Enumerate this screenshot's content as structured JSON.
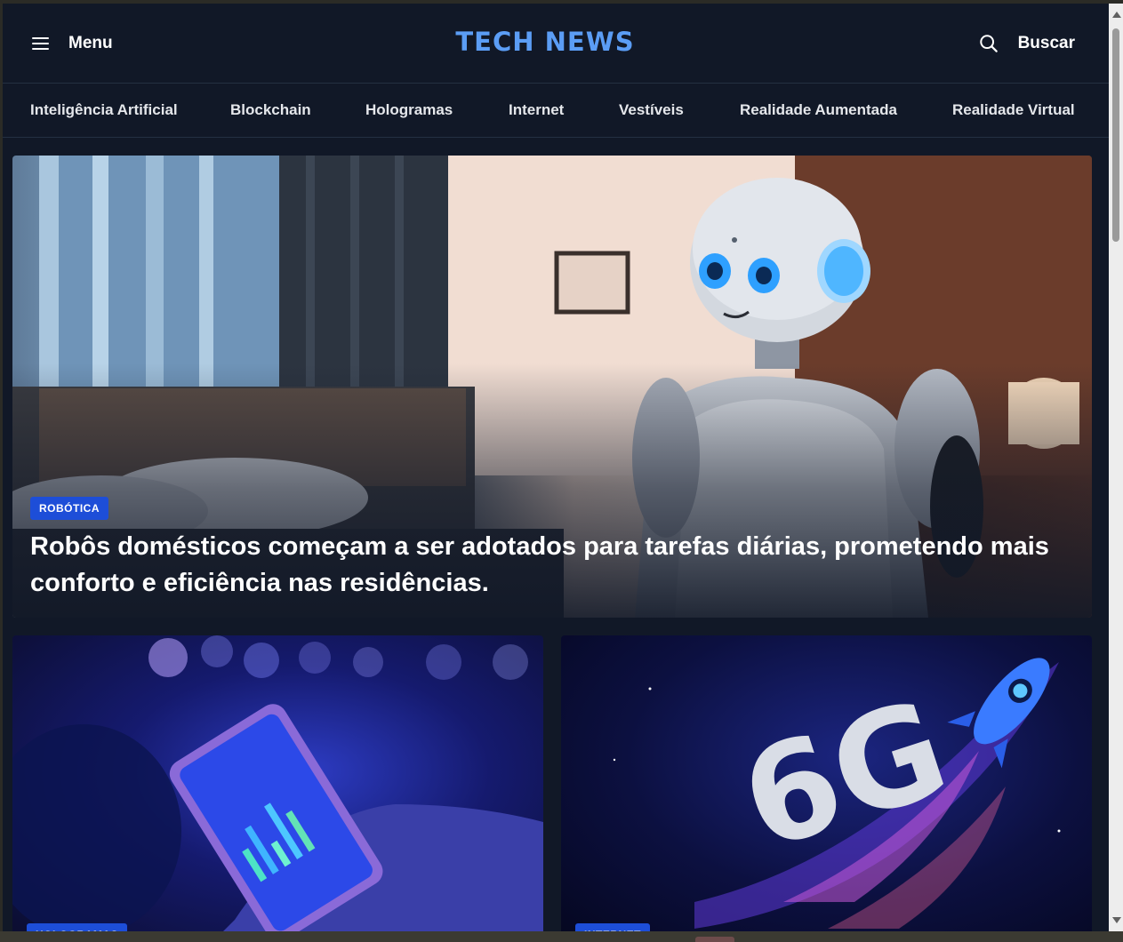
{
  "header": {
    "menu_label": "Menu",
    "logo": "TECH NEWS",
    "search_label": "Buscar"
  },
  "categories": [
    "Inteligência Artificial",
    "Blockchain",
    "Hologramas",
    "Internet",
    "Vestíveis",
    "Realidade Aumentada",
    "Realidade Virtual"
  ],
  "hero": {
    "category": "ROBÓTICA",
    "title": "Robôs domésticos começam a ser adotados para tarefas diárias, prometendo mais conforto e eficiência nas residências."
  },
  "cards": [
    {
      "category": "HOLOGRAMAS"
    },
    {
      "category": "INTERNET",
      "image_text": "6G"
    }
  ],
  "colors": {
    "background": "#111827",
    "logo": "#5b9df5",
    "badge": "#1d4ed8"
  },
  "icons": [
    "hamburger-icon",
    "search-icon"
  ]
}
